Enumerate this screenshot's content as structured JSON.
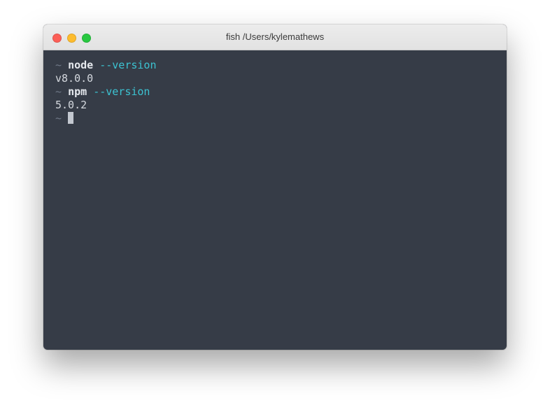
{
  "window": {
    "title": "fish  /Users/kylemathews",
    "traffic_lights": [
      {
        "name": "close",
        "color": "#fc5f57"
      },
      {
        "name": "minimize",
        "color": "#fdbc2e"
      },
      {
        "name": "zoom",
        "color": "#28c840"
      }
    ]
  },
  "colors": {
    "background": "#363c47",
    "argument": "#3cc3d2",
    "prompt": "#6f7887",
    "text": "#d4d8de"
  },
  "terminal": {
    "prompt_symbol": "~",
    "lines": [
      {
        "type": "command",
        "command": "node",
        "argument": "--version"
      },
      {
        "type": "output",
        "text": "v8.0.0"
      },
      {
        "type": "command",
        "command": "npm",
        "argument": "--version"
      },
      {
        "type": "output",
        "text": "5.0.2"
      },
      {
        "type": "prompt"
      }
    ]
  }
}
